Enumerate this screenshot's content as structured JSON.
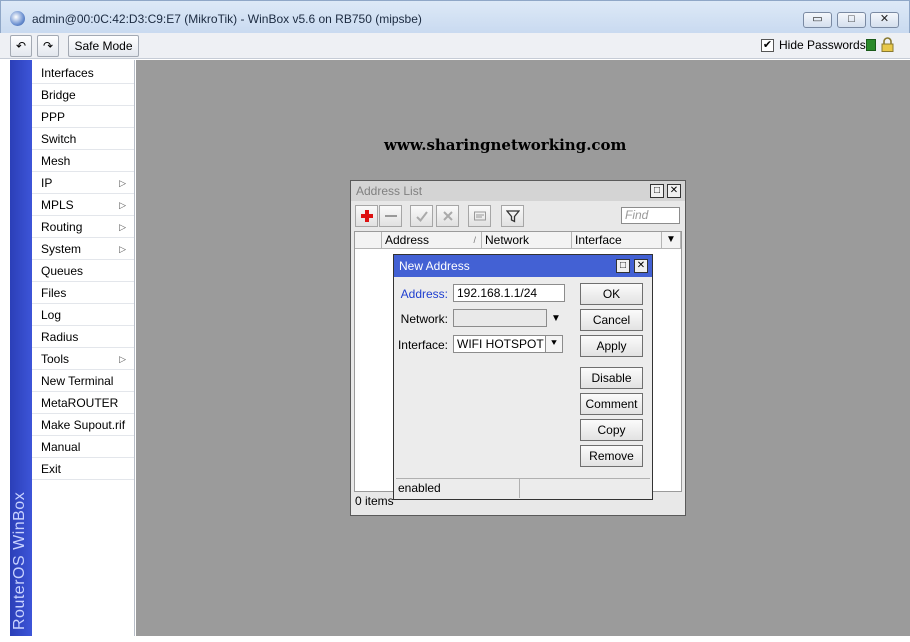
{
  "window": {
    "title": "admin@00:0C:42:D3:C9:E7 (MikroTik) - WinBox v5.6 on RB750 (mipsbe)",
    "minimize": "▭",
    "maximize": "□",
    "close": "✕"
  },
  "toolbar": {
    "undo": "↶",
    "redo": "↷",
    "safe_mode": "Safe Mode",
    "hide_passwords_label": "Hide Passwords",
    "hide_passwords_checked": "✔"
  },
  "brand": "RouterOS WinBox",
  "menu": [
    {
      "label": "Interfaces",
      "submenu": false
    },
    {
      "label": "Bridge",
      "submenu": false
    },
    {
      "label": "PPP",
      "submenu": false
    },
    {
      "label": "Switch",
      "submenu": false
    },
    {
      "label": "Mesh",
      "submenu": false
    },
    {
      "label": "IP",
      "submenu": true
    },
    {
      "label": "MPLS",
      "submenu": true
    },
    {
      "label": "Routing",
      "submenu": true
    },
    {
      "label": "System",
      "submenu": true
    },
    {
      "label": "Queues",
      "submenu": false
    },
    {
      "label": "Files",
      "submenu": false
    },
    {
      "label": "Log",
      "submenu": false
    },
    {
      "label": "Radius",
      "submenu": false
    },
    {
      "label": "Tools",
      "submenu": true
    },
    {
      "label": "New Terminal",
      "submenu": false
    },
    {
      "label": "MetaROUTER",
      "submenu": false
    },
    {
      "label": "Make Supout.rif",
      "submenu": false
    },
    {
      "label": "Manual",
      "submenu": false
    },
    {
      "label": "Exit",
      "submenu": false
    }
  ],
  "submenu_arrow": "▷",
  "watermark": "www.sharingnetworking.com",
  "address_list": {
    "title": "Address List",
    "find_placeholder": "Find",
    "columns": [
      "Address",
      "Network",
      "Interface"
    ],
    "sort_indicator": "/",
    "items_count": "0 items"
  },
  "new_address": {
    "title": "New Address",
    "address_label": "Address:",
    "address_value": "192.168.1.1/24",
    "network_label": "Network:",
    "network_value": "",
    "interface_label": "Interface:",
    "interface_value": "WIFI HOTSPOT",
    "buttons": {
      "ok": "OK",
      "cancel": "Cancel",
      "apply": "Apply",
      "disable": "Disable",
      "comment": "Comment",
      "copy": "Copy",
      "remove": "Remove"
    },
    "status": "enabled",
    "colors": {
      "title_bar": "#4361d4",
      "address_label": "#1f3fd0"
    }
  }
}
